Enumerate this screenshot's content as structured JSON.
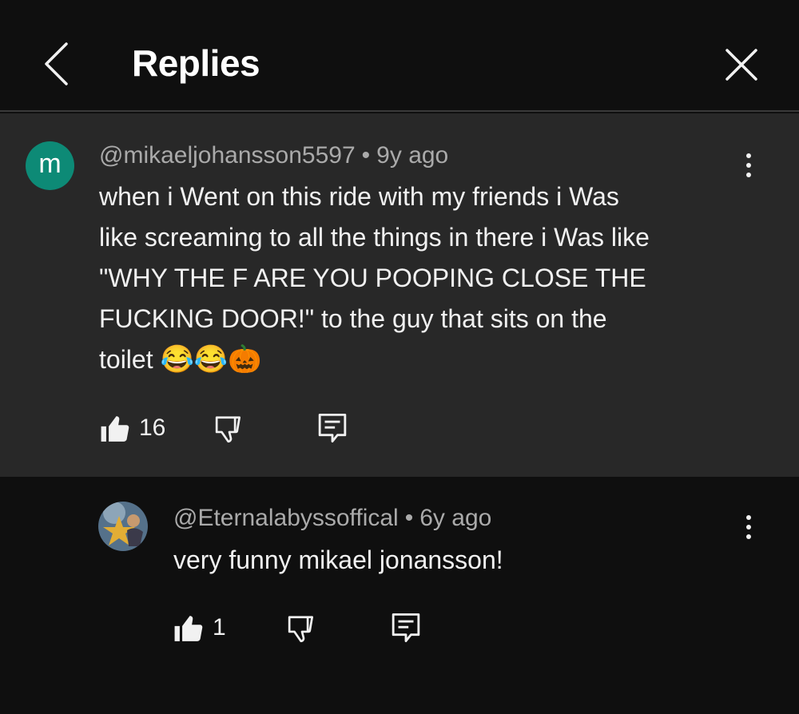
{
  "header": {
    "title": "Replies"
  },
  "parent_comment": {
    "avatar_letter": "m",
    "author": "@mikaeljohansson5597",
    "separator": "•",
    "age": "9y ago",
    "text": "when i Went on this ride with my friends i Was\nlike screaming to all the things in there i Was like\n\"WHY THE F ARE YOU POOPING CLOSE THE\nFUCKING DOOR!\" to the guy that sits on the\ntoilet ",
    "emojis": "😂😂🎃",
    "like_count": "16"
  },
  "reply": {
    "author": "@Eternalabyssoffical",
    "separator": "•",
    "age": "6y ago",
    "text": "very funny mikael jonansson!",
    "like_count": "1"
  },
  "icons": {
    "back": "chevron-left-icon",
    "close": "close-icon",
    "more": "more-vert-icon",
    "like": "thumbs-up-icon",
    "dislike": "thumbs-down-icon",
    "reply": "comment-icon"
  },
  "colors": {
    "background": "#0f0f0f",
    "parent_background": "#282828",
    "avatar": "#0d8a76",
    "text": "#f1f1f1",
    "secondary_text": "#aaaaaa"
  }
}
